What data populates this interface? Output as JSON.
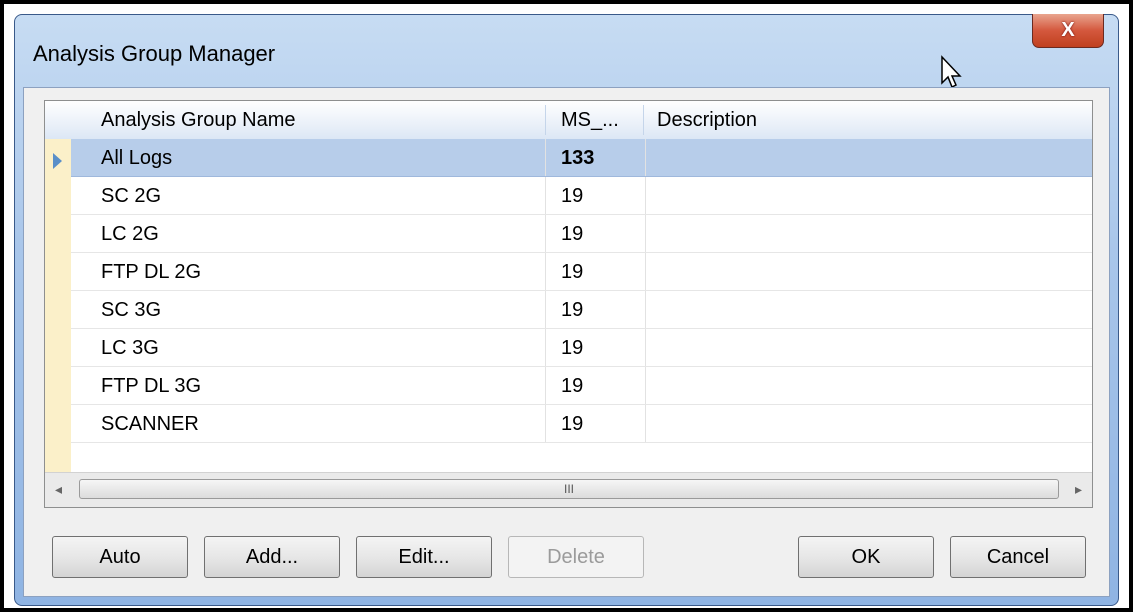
{
  "window": {
    "title": "Analysis Group Manager",
    "close_label": "X"
  },
  "grid": {
    "columns": [
      "Analysis Group Name",
      "MS_...",
      "Description"
    ],
    "rows": [
      {
        "name": "All Logs",
        "ms": "133",
        "description": ""
      },
      {
        "name": "SC 2G",
        "ms": "19",
        "description": ""
      },
      {
        "name": "LC 2G",
        "ms": "19",
        "description": ""
      },
      {
        "name": "FTP DL 2G",
        "ms": "19",
        "description": ""
      },
      {
        "name": "SC 3G",
        "ms": "19",
        "description": ""
      },
      {
        "name": "LC 3G",
        "ms": "19",
        "description": ""
      },
      {
        "name": "FTP DL 3G",
        "ms": "19",
        "description": ""
      },
      {
        "name": "SCANNER",
        "ms": "19",
        "description": ""
      }
    ],
    "scrollbar": {
      "left_arrow": "◂",
      "right_arrow": "▸",
      "grip": "III"
    }
  },
  "buttons": {
    "auto": "Auto",
    "add": "Add...",
    "edit": "Edit...",
    "delete": "Delete",
    "ok": "OK",
    "cancel": "Cancel"
  },
  "colors": {
    "selection": "#b7cdea",
    "row_header": "#fbf0c9",
    "close_button": "#c0401f"
  }
}
